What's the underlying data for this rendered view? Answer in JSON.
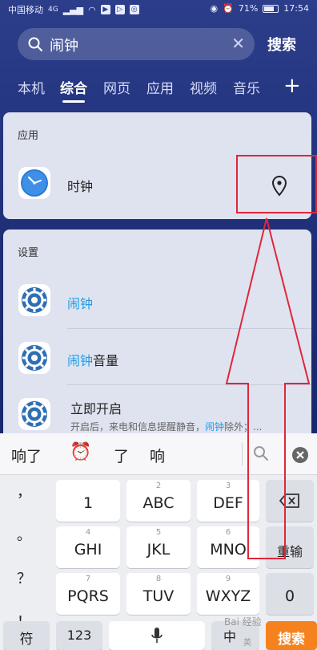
{
  "status_bar": {
    "carrier": "中国移动",
    "network": "4G",
    "battery": "71%",
    "time": "17:54"
  },
  "search": {
    "query": "闹钟",
    "button_label": "搜索"
  },
  "tabs": [
    "本机",
    "综合",
    "网页",
    "应用",
    "视频",
    "音乐"
  ],
  "active_tab": "综合",
  "apps_section": {
    "title": "应用",
    "item_label": "时钟"
  },
  "settings_section": {
    "title": "设置",
    "items": [
      {
        "highlight": "闹钟",
        "rest": ""
      },
      {
        "highlight": "闹钟",
        "rest": "音量"
      },
      {
        "highlight": "",
        "rest": "立即开启"
      }
    ],
    "item3_sub_prefix": "开启后，来电和信息提醒静音，",
    "item3_sub_highlight": "闹钟",
    "item3_sub_suffix": "除外；..."
  },
  "keyboard": {
    "candidates": [
      "响了",
      "⏰",
      "了",
      "响"
    ],
    "punctuation": [
      "，",
      "。",
      "？",
      "！"
    ],
    "keys": [
      {
        "num": "",
        "label": "1"
      },
      {
        "num": "2",
        "label": "ABC"
      },
      {
        "num": "3",
        "label": "DEF"
      },
      {
        "num": "4",
        "label": "GHI"
      },
      {
        "num": "5",
        "label": "JKL"
      },
      {
        "num": "6",
        "label": "MNO"
      },
      {
        "num": "7",
        "label": "PQRS"
      },
      {
        "num": "8",
        "label": "TUV"
      },
      {
        "num": "9",
        "label": "WXYZ"
      }
    ],
    "reenter_label": "重输",
    "zero_label": "0",
    "symbol_label": "符",
    "num_label": "123",
    "lang_label": "中",
    "lang_sub": "英",
    "search_key_label": "搜索"
  },
  "watermark": "Bai 经验",
  "colors": {
    "background": "#1f2f78",
    "card": "#dfe3ef",
    "highlight": "#1f9ee6",
    "annotation": "#e0263a",
    "search_key": "#f5821f"
  }
}
